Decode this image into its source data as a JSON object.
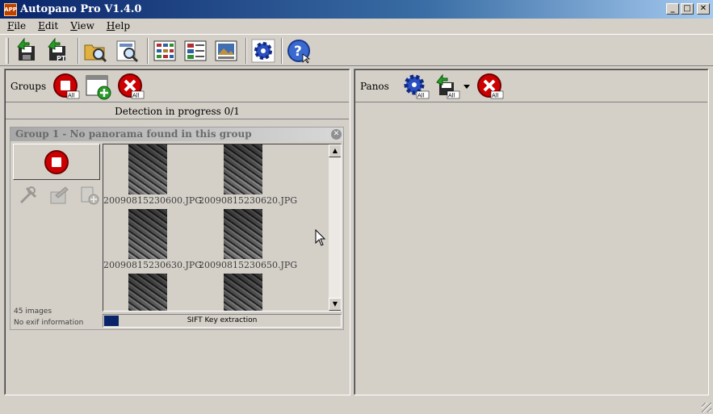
{
  "window": {
    "title": "Autopano Pro V1.4.0",
    "icon_text": "APP"
  },
  "menu": [
    {
      "label_u": "F",
      "label_rest": "ile"
    },
    {
      "label_u": "E",
      "label_rest": "dit"
    },
    {
      "label_u": "V",
      "label_rest": "iew"
    },
    {
      "label_u": "H",
      "label_rest": "elp"
    }
  ],
  "toolbar": {
    "buttons": [
      "save-icon",
      "export-pt-icon",
      "open-folder-icon",
      "search-images-icon",
      "view-list-icon",
      "view-detail-icon",
      "view-preview-icon",
      "settings-gear-icon",
      "help-icon"
    ],
    "pt_label": "PT"
  },
  "groups_panel": {
    "label": "Groups",
    "all_badge": "All",
    "status": "Detection in progress 0/1",
    "group": {
      "title": "Group 1 - No panorama found in this group",
      "image_count": "45 images",
      "exif_info": "No exif information",
      "thumbnails": [
        "20090815230600.JPG",
        "20090815230620.JPG",
        "20090815230630.JPG",
        "20090815230650.JPG",
        "",
        ""
      ],
      "progress_label": "SIFT Key extraction",
      "progress_fraction": 0.06
    }
  },
  "panos_panel": {
    "label": "Panos",
    "all_badge": "All"
  },
  "colors": {
    "accent_red": "#cc0000",
    "accent_blue": "#2a4fc0",
    "progress": "#0a246a"
  }
}
